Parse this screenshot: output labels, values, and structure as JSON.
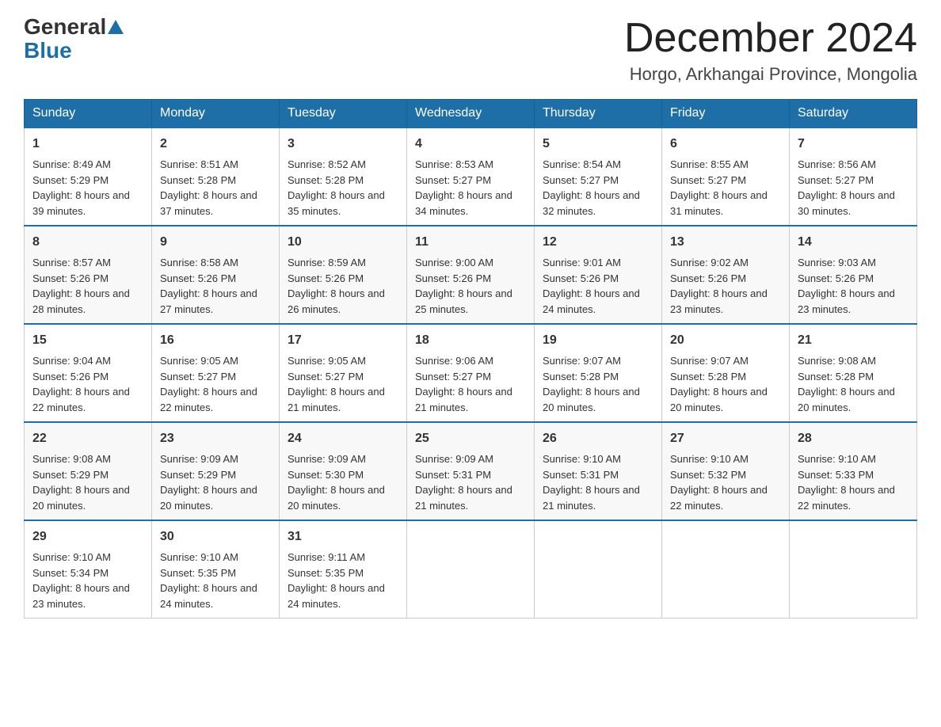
{
  "header": {
    "logo_general": "General",
    "logo_blue": "Blue",
    "month_title": "December 2024",
    "location": "Horgo, Arkhangai Province, Mongolia"
  },
  "days_of_week": [
    "Sunday",
    "Monday",
    "Tuesday",
    "Wednesday",
    "Thursday",
    "Friday",
    "Saturday"
  ],
  "weeks": [
    [
      {
        "day": "1",
        "sunrise": "8:49 AM",
        "sunset": "5:29 PM",
        "daylight": "8 hours and 39 minutes."
      },
      {
        "day": "2",
        "sunrise": "8:51 AM",
        "sunset": "5:28 PM",
        "daylight": "8 hours and 37 minutes."
      },
      {
        "day": "3",
        "sunrise": "8:52 AM",
        "sunset": "5:28 PM",
        "daylight": "8 hours and 35 minutes."
      },
      {
        "day": "4",
        "sunrise": "8:53 AM",
        "sunset": "5:27 PM",
        "daylight": "8 hours and 34 minutes."
      },
      {
        "day": "5",
        "sunrise": "8:54 AM",
        "sunset": "5:27 PM",
        "daylight": "8 hours and 32 minutes."
      },
      {
        "day": "6",
        "sunrise": "8:55 AM",
        "sunset": "5:27 PM",
        "daylight": "8 hours and 31 minutes."
      },
      {
        "day": "7",
        "sunrise": "8:56 AM",
        "sunset": "5:27 PM",
        "daylight": "8 hours and 30 minutes."
      }
    ],
    [
      {
        "day": "8",
        "sunrise": "8:57 AM",
        "sunset": "5:26 PM",
        "daylight": "8 hours and 28 minutes."
      },
      {
        "day": "9",
        "sunrise": "8:58 AM",
        "sunset": "5:26 PM",
        "daylight": "8 hours and 27 minutes."
      },
      {
        "day": "10",
        "sunrise": "8:59 AM",
        "sunset": "5:26 PM",
        "daylight": "8 hours and 26 minutes."
      },
      {
        "day": "11",
        "sunrise": "9:00 AM",
        "sunset": "5:26 PM",
        "daylight": "8 hours and 25 minutes."
      },
      {
        "day": "12",
        "sunrise": "9:01 AM",
        "sunset": "5:26 PM",
        "daylight": "8 hours and 24 minutes."
      },
      {
        "day": "13",
        "sunrise": "9:02 AM",
        "sunset": "5:26 PM",
        "daylight": "8 hours and 23 minutes."
      },
      {
        "day": "14",
        "sunrise": "9:03 AM",
        "sunset": "5:26 PM",
        "daylight": "8 hours and 23 minutes."
      }
    ],
    [
      {
        "day": "15",
        "sunrise": "9:04 AM",
        "sunset": "5:26 PM",
        "daylight": "8 hours and 22 minutes."
      },
      {
        "day": "16",
        "sunrise": "9:05 AM",
        "sunset": "5:27 PM",
        "daylight": "8 hours and 22 minutes."
      },
      {
        "day": "17",
        "sunrise": "9:05 AM",
        "sunset": "5:27 PM",
        "daylight": "8 hours and 21 minutes."
      },
      {
        "day": "18",
        "sunrise": "9:06 AM",
        "sunset": "5:27 PM",
        "daylight": "8 hours and 21 minutes."
      },
      {
        "day": "19",
        "sunrise": "9:07 AM",
        "sunset": "5:28 PM",
        "daylight": "8 hours and 20 minutes."
      },
      {
        "day": "20",
        "sunrise": "9:07 AM",
        "sunset": "5:28 PM",
        "daylight": "8 hours and 20 minutes."
      },
      {
        "day": "21",
        "sunrise": "9:08 AM",
        "sunset": "5:28 PM",
        "daylight": "8 hours and 20 minutes."
      }
    ],
    [
      {
        "day": "22",
        "sunrise": "9:08 AM",
        "sunset": "5:29 PM",
        "daylight": "8 hours and 20 minutes."
      },
      {
        "day": "23",
        "sunrise": "9:09 AM",
        "sunset": "5:29 PM",
        "daylight": "8 hours and 20 minutes."
      },
      {
        "day": "24",
        "sunrise": "9:09 AM",
        "sunset": "5:30 PM",
        "daylight": "8 hours and 20 minutes."
      },
      {
        "day": "25",
        "sunrise": "9:09 AM",
        "sunset": "5:31 PM",
        "daylight": "8 hours and 21 minutes."
      },
      {
        "day": "26",
        "sunrise": "9:10 AM",
        "sunset": "5:31 PM",
        "daylight": "8 hours and 21 minutes."
      },
      {
        "day": "27",
        "sunrise": "9:10 AM",
        "sunset": "5:32 PM",
        "daylight": "8 hours and 22 minutes."
      },
      {
        "day": "28",
        "sunrise": "9:10 AM",
        "sunset": "5:33 PM",
        "daylight": "8 hours and 22 minutes."
      }
    ],
    [
      {
        "day": "29",
        "sunrise": "9:10 AM",
        "sunset": "5:34 PM",
        "daylight": "8 hours and 23 minutes."
      },
      {
        "day": "30",
        "sunrise": "9:10 AM",
        "sunset": "5:35 PM",
        "daylight": "8 hours and 24 minutes."
      },
      {
        "day": "31",
        "sunrise": "9:11 AM",
        "sunset": "5:35 PM",
        "daylight": "8 hours and 24 minutes."
      },
      null,
      null,
      null,
      null
    ]
  ],
  "labels": {
    "sunrise": "Sunrise:",
    "sunset": "Sunset:",
    "daylight": "Daylight:"
  }
}
